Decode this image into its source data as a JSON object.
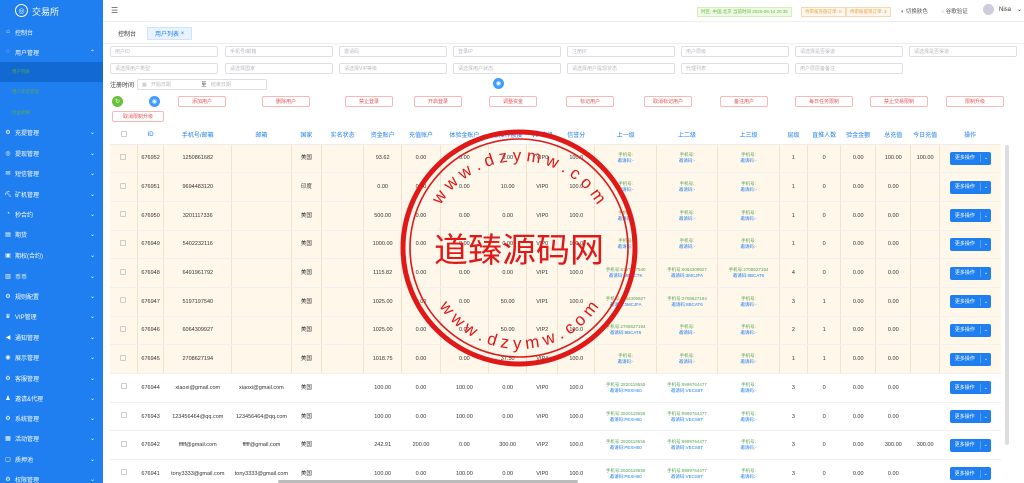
{
  "app": {
    "logo_glyph": "◎",
    "title": "交易所"
  },
  "sidebar": {
    "items": [
      {
        "icon": "⌂",
        "label": "控制台"
      },
      {
        "icon": "◌",
        "label": "用户管理",
        "chev": "⌃"
      },
      {
        "label": "用户列表"
      },
      {
        "label": "用户实名管理"
      },
      {
        "label": "资金明细"
      },
      {
        "icon": "⚙",
        "label": "充提管理",
        "chev": "⌄"
      },
      {
        "icon": "◎",
        "label": "提现管理",
        "chev": "⌄"
      },
      {
        "icon": "✉",
        "label": "短信管理",
        "chev": "⌄"
      },
      {
        "icon": "⛏",
        "label": "矿机管理",
        "chev": "⌄"
      },
      {
        "icon": "◔",
        "label": "秒合约",
        "chev": "⌄"
      },
      {
        "icon": "▤",
        "label": "期货",
        "chev": "⌄"
      },
      {
        "icon": "▣",
        "label": "期权(合约)",
        "chev": "⌄"
      },
      {
        "icon": "▥",
        "label": "币币",
        "chev": "⌄"
      },
      {
        "icon": "⚙",
        "label": "规则配置",
        "chev": "⌄"
      },
      {
        "icon": "♛",
        "label": "VIP管理",
        "chev": "⌄"
      },
      {
        "icon": "◀",
        "label": "通知管理",
        "chev": "⌄"
      },
      {
        "icon": "◉",
        "label": "展示管理",
        "chev": "⌄"
      },
      {
        "icon": "⚙",
        "label": "客服管理",
        "chev": "⌄"
      },
      {
        "icon": "♟",
        "label": "邀请&代理",
        "chev": "⌄"
      },
      {
        "icon": "⚙",
        "label": "系统管理",
        "chev": "⌄"
      },
      {
        "icon": "▦",
        "label": "活动管理",
        "chev": "⌄"
      },
      {
        "icon": "▢",
        "label": "质押池",
        "chev": "⌄"
      },
      {
        "icon": "⚙",
        "label": "权限管理",
        "chev": "⌄"
      }
    ]
  },
  "header": {
    "menu_icon": "☰",
    "tag1": "时区: 中国,北京 当前时间 2025-06-14 20:35",
    "tag2": "待审核充值订单: 0",
    "tag3": "待审核提现订单: 3",
    "theme_label": "切换肤色",
    "auth_label": "谷歌验证",
    "user_name": "Nisa",
    "caret": "⌄"
  },
  "tabs": {
    "home": "控制台",
    "current": "用户列表",
    "close": "×"
  },
  "filters": {
    "row1": [
      "用户ID",
      "手机号/邮箱",
      "邀请码",
      "登录IP",
      "注册IP",
      "用户层级",
      "请选择是否渠道",
      "请选择是否渠道"
    ],
    "row2": [
      "请选择用户类型",
      "请选择国家",
      "请选择VIP等级",
      "请选择用户状态",
      "请选择用户提现状态",
      "代理列表",
      "用户层层备备注"
    ],
    "date_label": "注册时间",
    "date_start": "开始日期",
    "date_end": "结束日期",
    "date_sep": "至",
    "cal": "▦"
  },
  "actions": {
    "refresh": "↻",
    "search_circle": "◉",
    "btns": [
      "添加用户",
      "删除用户",
      "禁止登录",
      "开启登录",
      "调整资金",
      "标记用户",
      "取消标记用户",
      "备注用户",
      "每日任务限制",
      "禁止交易限制",
      "限制升级",
      "取消限制升级"
    ]
  },
  "table": {
    "headers": [
      "ID",
      "手机号/邮箱",
      "邮箱",
      "国家",
      "实名状态",
      "资金账户",
      "充值账户",
      "体验金账户",
      "总操作额度",
      "VIP等级",
      "信誉分",
      "上一级",
      "上二级",
      "上三级",
      "层级",
      "直推人数",
      "验金金额",
      "总充值",
      "今日充值",
      "操作"
    ],
    "rows": [
      {
        "id": "676952",
        "phone": "1250861682",
        "email": "",
        "country": "美国",
        "kyc": "",
        "fund": "93.62",
        "rech": "0.00",
        "exp": "0.00",
        "tot": "0.00",
        "vip": "VIP0",
        "score": "100.0",
        "u1": [
          "",
          "-"
        ],
        "u2": [
          "",
          "-"
        ],
        "u3": [
          "",
          "-"
        ],
        "lvl": "1",
        "inv": "0",
        "gold": "0.00",
        "all": "100.00",
        "today": "100.00",
        "hl": true
      },
      {
        "id": "676951",
        "phone": "9694483120",
        "email": "",
        "country": "印度",
        "kyc": "",
        "fund": "0.00",
        "rech": "0.00",
        "exp": "0.00",
        "tot": "10.00",
        "vip": "VIP0",
        "score": "100.0",
        "u1": [
          "",
          "-"
        ],
        "u2": [
          "",
          "-"
        ],
        "u3": [
          "",
          "-"
        ],
        "lvl": "1",
        "inv": "0",
        "gold": "0.00",
        "all": "0.00",
        "today": "",
        "hl": true
      },
      {
        "id": "676950",
        "phone": "3201117336",
        "email": "",
        "country": "美国",
        "kyc": "",
        "fund": "500.00",
        "rech": "0.00",
        "exp": "0.00",
        "tot": "0.00",
        "vip": "VIP0",
        "score": "100.0",
        "u1": [
          "",
          "-"
        ],
        "u2": [
          "",
          "-"
        ],
        "u3": [
          "",
          "-"
        ],
        "lvl": "1",
        "inv": "0",
        "gold": "0.00",
        "all": "0.00",
        "today": "",
        "hl": true
      },
      {
        "id": "676949",
        "phone": "5402232116",
        "email": "",
        "country": "美国",
        "kyc": "",
        "fund": "1000.00",
        "rech": "0.00",
        "exp": "0.00",
        "tot": "0.00",
        "vip": "VIP0",
        "score": "100.0",
        "u1": [
          "",
          "-"
        ],
        "u2": [
          "",
          "-"
        ],
        "u3": [
          "",
          "-"
        ],
        "lvl": "1",
        "inv": "0",
        "gold": "0.00",
        "all": "0.00",
        "today": "",
        "hl": true
      },
      {
        "id": "676948",
        "phone": "6491961792",
        "email": "",
        "country": "美国",
        "kyc": "",
        "fund": "1115.82",
        "rech": "0.00",
        "exp": "0.00",
        "tot": "0.00",
        "vip": "VIP1",
        "score": "100.0",
        "u1": [
          "5197197540",
          "MERCTK"
        ],
        "u2": [
          "6064309927",
          "3MCJFA"
        ],
        "u3": [
          "2708627194",
          "8BCAT6"
        ],
        "lvl": "4",
        "inv": "0",
        "gold": "0.00",
        "all": "0.00",
        "today": "",
        "hl": true
      },
      {
        "id": "676947",
        "phone": "5197197540",
        "email": "",
        "country": "美国",
        "kyc": "",
        "fund": "1025.00",
        "rech": "0.00",
        "exp": "0.00",
        "tot": "50.00",
        "vip": "VIP1",
        "score": "100.0",
        "u1": [
          "6064309927",
          "3MCJFA"
        ],
        "u2": [
          "2708627194",
          "8BCAT6"
        ],
        "u3": [
          "",
          "-"
        ],
        "lvl": "3",
        "inv": "1",
        "gold": "0.00",
        "all": "0.00",
        "today": "",
        "hl": true
      },
      {
        "id": "676946",
        "phone": "6064309927",
        "email": "",
        "country": "美国",
        "kyc": "",
        "fund": "1025.00",
        "rech": "0.00",
        "exp": "0.00",
        "tot": "50.00",
        "vip": "VIP2",
        "score": "100.0",
        "u1": [
          "2708627194",
          "8BCAT6"
        ],
        "u2": [
          "",
          "-"
        ],
        "u3": [
          "",
          "-"
        ],
        "lvl": "2",
        "inv": "1",
        "gold": "0.00",
        "all": "0.00",
        "today": "",
        "hl": true
      },
      {
        "id": "676945",
        "phone": "2708627194",
        "email": "",
        "country": "美国",
        "kyc": "",
        "fund": "1018.75",
        "rech": "0.00",
        "exp": "0.00",
        "tot": "37.50",
        "vip": "VIP4",
        "score": "100.0",
        "u1": [
          "",
          "-"
        ],
        "u2": [
          "",
          "-"
        ],
        "u3": [
          "",
          "-"
        ],
        "lvl": "1",
        "inv": "1",
        "gold": "0.00",
        "all": "0.00",
        "today": "",
        "hl": true
      },
      {
        "id": "676944",
        "phone": "xiaoxi@gmail.com",
        "email": "xiaoxi@gmail.com",
        "country": "美国",
        "kyc": "",
        "fund": "100.00",
        "rech": "0.00",
        "exp": "100.00",
        "tot": "0.00",
        "vip": "VIP0",
        "score": "100.0",
        "u1": [
          "2820119555",
          "PEXH60"
        ],
        "u2": [
          "9999764477",
          "VECS8T"
        ],
        "u3": [
          "",
          "-"
        ],
        "lvl": "3",
        "inv": "0",
        "gold": "0.00",
        "all": "0.00",
        "today": "",
        "hl": false
      },
      {
        "id": "676943",
        "phone": "123456464@qq.com",
        "email": "123456464@qq.com",
        "country": "美国",
        "kyc": "",
        "fund": "100.00",
        "rech": "0.00",
        "exp": "100.00",
        "tot": "0.00",
        "vip": "VIP0",
        "score": "100.0",
        "u1": [
          "2820119555",
          "PEXH60"
        ],
        "u2": [
          "9999764477",
          "VECS8T"
        ],
        "u3": [
          "",
          "-"
        ],
        "lvl": "3",
        "inv": "0",
        "gold": "0.00",
        "all": "0.00",
        "today": "",
        "hl": false
      },
      {
        "id": "676942",
        "phone": "fffff@gmail.com",
        "email": "fffff@gmail.com",
        "country": "美国",
        "kyc": "",
        "fund": "242.91",
        "rech": "200.00",
        "exp": "0.00",
        "tot": "300.00",
        "vip": "VIP2",
        "score": "100.0",
        "u1": [
          "2820119555",
          "PEXH60"
        ],
        "u2": [
          "9999764477",
          "VECS8T"
        ],
        "u3": [
          "",
          "-"
        ],
        "lvl": "3",
        "inv": "0",
        "gold": "0.00",
        "all": "300.00",
        "today": "300.00",
        "hl": false
      },
      {
        "id": "676941",
        "phone": "tony3333@gmail.com",
        "email": "tony3333@gmail.com",
        "country": "美国",
        "kyc": "",
        "fund": "100.00",
        "rech": "0.00",
        "exp": "100.00",
        "tot": "0.00",
        "vip": "VIP0",
        "score": "100.0",
        "u1": [
          "2820119555",
          "PEXH60"
        ],
        "u2": [
          "9999764477",
          "VECS8T"
        ],
        "u3": [
          "",
          "-"
        ],
        "lvl": "3",
        "inv": "0",
        "gold": "0.00",
        "all": "0.00",
        "today": "",
        "hl": false
      }
    ],
    "sub_label_phone": "手机号:",
    "sub_label_code": "邀请码:",
    "op_label": "更多操作",
    "op_caret": "⌄"
  },
  "watermark": {
    "top": "w w w . d z y m w . c o m",
    "bottom": "w w w . d z y m w . c o m",
    "center": "道臻源码网",
    "color": "#e01818"
  }
}
